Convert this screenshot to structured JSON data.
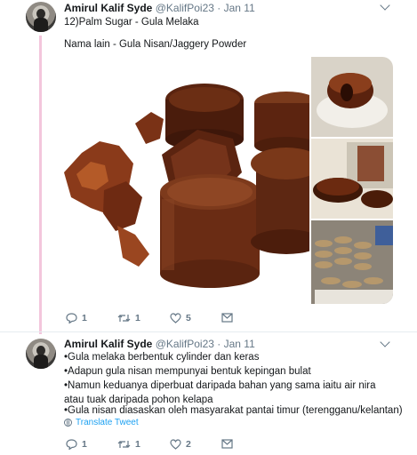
{
  "tweet1": {
    "author_name": "Amirul Kalif Syde",
    "handle": "@KalifPoi23",
    "separator": "·",
    "date": "Jan 11",
    "title": "12)Palm Sugar - Gula Melaka",
    "body": "Nama lain - Gula Nisan/Jaggery Powder",
    "actions": {
      "reply_count": "1",
      "retweet_count": "1",
      "like_count": "5"
    }
  },
  "tweet2": {
    "author_name": "Amirul Kalif Syde",
    "handle": "@KalifPoi23",
    "separator": "·",
    "date": "Jan 11",
    "lines": [
      "•Gula melaka berbentuk cylinder dan keras",
      "•Adapun gula nisan mempunyai bentuk kepingan bulat",
      "•Namun keduanya diperbuat daripada bahan yang sama iaitu air nira atau tuak daripada pohon kelapa",
      "•Gula nisan diasaskan oleh masyarakat pantai timur (terengganu/kelantan)"
    ],
    "translate_label": "Translate Tweet",
    "actions": {
      "reply_count": "1",
      "retweet_count": "1",
      "like_count": "2"
    }
  },
  "icons": {
    "reply": "reply-icon",
    "retweet": "retweet-icon",
    "like": "heart-icon",
    "message": "direct-message-icon",
    "more": "chevron-down-icon",
    "translate": "globe-icon"
  },
  "colors": {
    "thread_line": "#f3c6dc",
    "secondary_text": "#657786",
    "link": "#1da1f2"
  }
}
